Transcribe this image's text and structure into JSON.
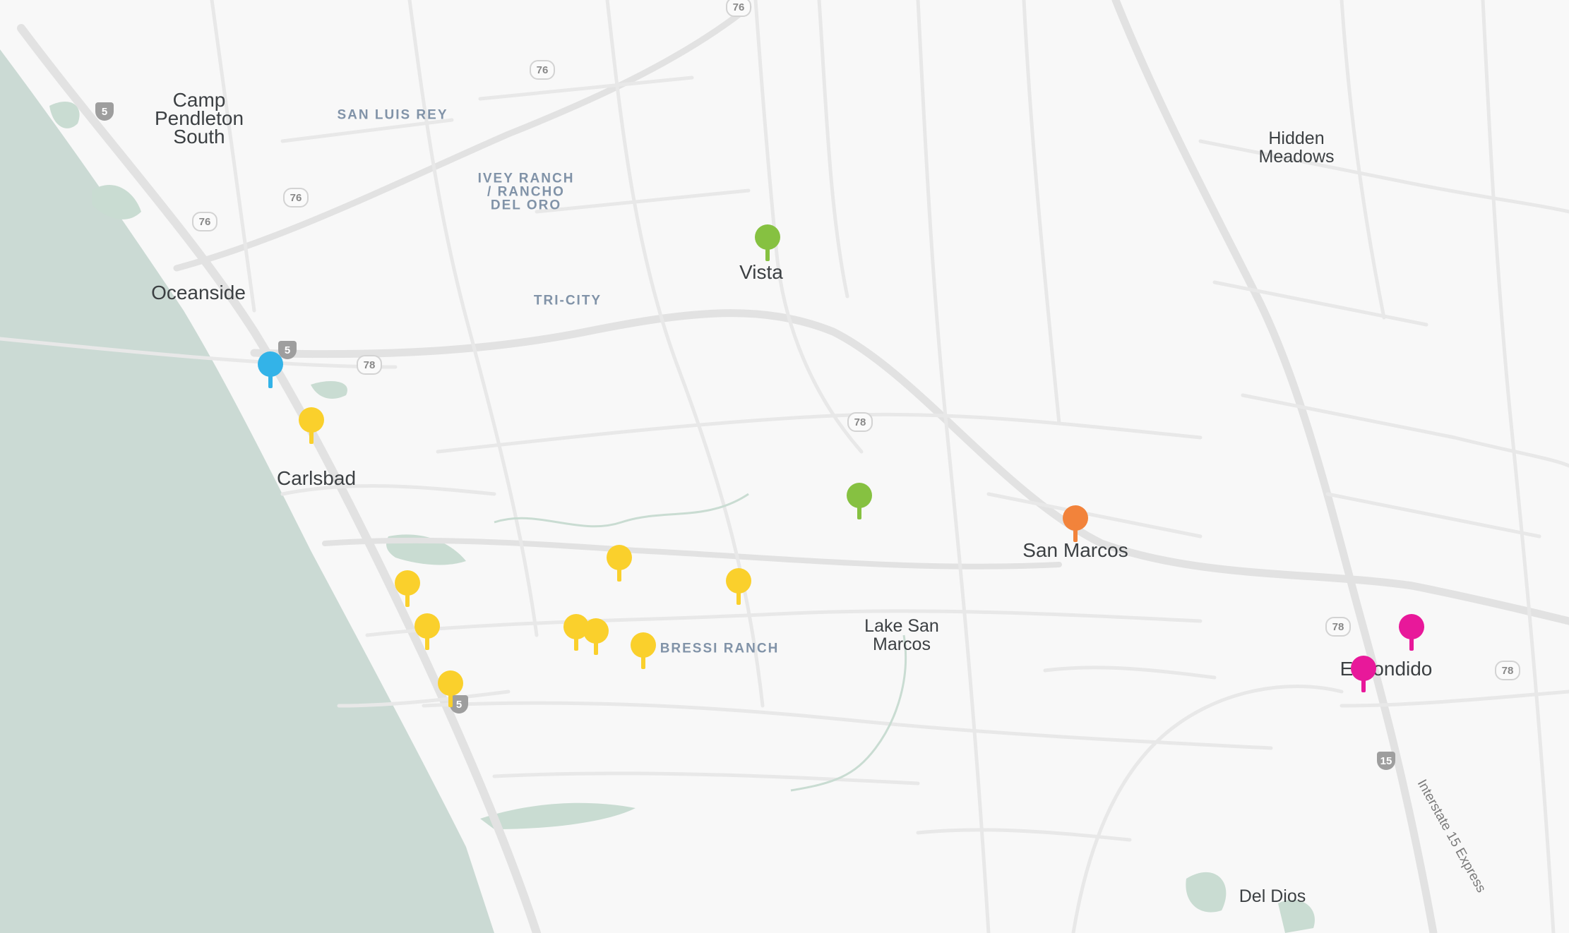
{
  "palette": {
    "land": "#f8f8f8",
    "water": "#cbdad4",
    "road": "#e6e6e6",
    "park": "#c9dcd2"
  },
  "markers": [
    {
      "id": "oceanside",
      "color": "#33b3e8"
    },
    {
      "id": "carlsbad-north",
      "color": "#fad02c"
    },
    {
      "id": "vista",
      "color": "#86c141"
    },
    {
      "id": "vista-south",
      "color": "#86c141"
    },
    {
      "id": "san-marcos",
      "color": "#f2833b"
    },
    {
      "id": "carlsbad-coast-1",
      "color": "#fad02c"
    },
    {
      "id": "carlsbad-coast-2",
      "color": "#fad02c"
    },
    {
      "id": "carlsbad-coast-3",
      "color": "#fad02c"
    },
    {
      "id": "carlsbad-inland-1",
      "color": "#fad02c"
    },
    {
      "id": "carlsbad-inland-2",
      "color": "#fad02c"
    },
    {
      "id": "bressi-1",
      "color": "#fad02c"
    },
    {
      "id": "bressi-2",
      "color": "#fad02c"
    },
    {
      "id": "bressi-3",
      "color": "#fad02c"
    },
    {
      "id": "escondido-1",
      "color": "#e8189a"
    },
    {
      "id": "escondido-2",
      "color": "#e8189a"
    }
  ],
  "places": {
    "camp_pendleton": "Camp\nPendleton\nSouth",
    "oceanside": "Oceanside",
    "carlsbad": "Carlsbad",
    "vista": "Vista",
    "san_marcos": "San Marcos",
    "lake_san_marcos": "Lake San\nMarcos",
    "hidden_meadows": "Hidden\nMeadows",
    "escondido": "Escondido",
    "del_dios": "Del Dios"
  },
  "neighborhoods": {
    "san_luis_rey": "SAN LUIS REY",
    "ivey_ranch": "IVEY RANCH\n/ RANCHO\nDEL ORO",
    "tri_city": "TRI-CITY",
    "bressi_ranch": "BRESSI RANCH"
  },
  "roads": {
    "i15_express": "Interstate 15 Express",
    "r76": "76",
    "r78": "78",
    "i5": "5",
    "i15": "15"
  }
}
